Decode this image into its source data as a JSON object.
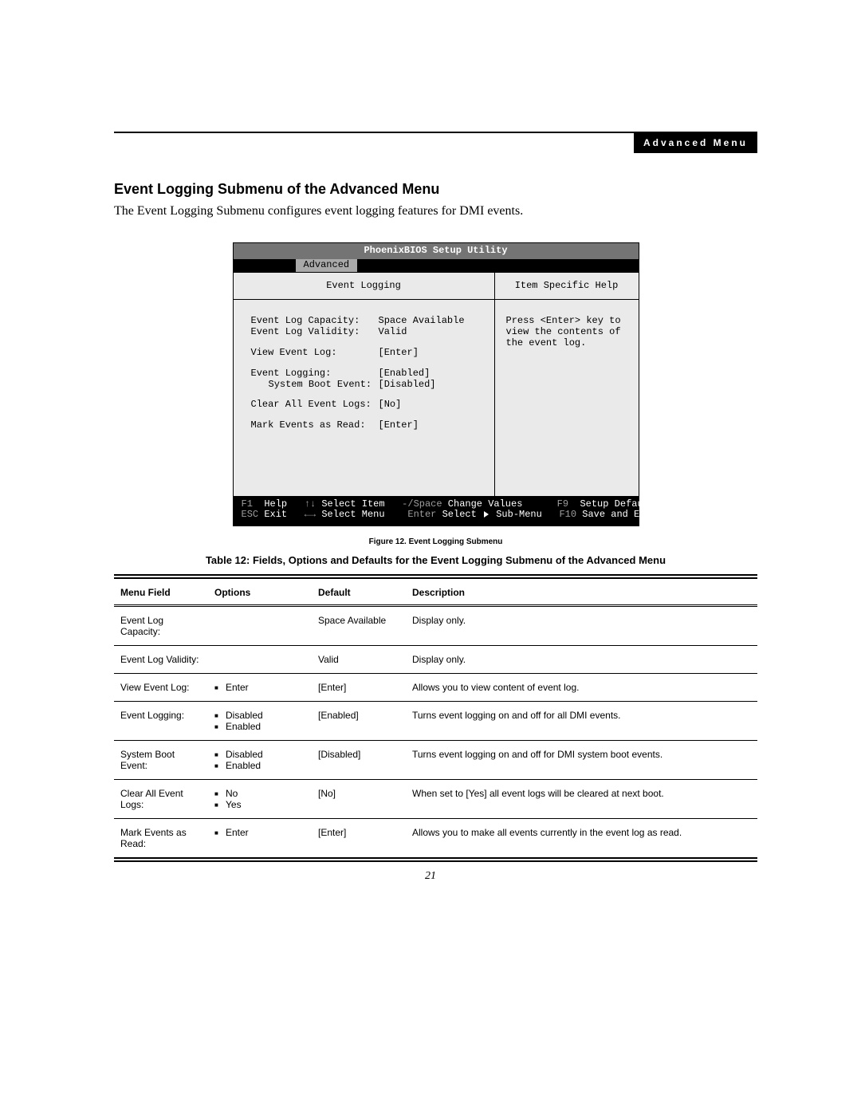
{
  "header": {
    "pill": "Advanced Menu"
  },
  "section_title": "Event Logging Submenu of the Advanced Menu",
  "intro": "The Event Logging Submenu configures event logging features for DMI events.",
  "bios": {
    "title": "PhoenixBIOS Setup Utility",
    "tab": "Advanced",
    "left_header": "Event Logging",
    "right_header": "Item Specific Help",
    "help_lines": [
      "Press <Enter> key to",
      "view the contents of",
      "the event log."
    ],
    "fields": {
      "capacity_label": "Event Log Capacity:",
      "capacity_value": "Space Available",
      "validity_label": "Event Log Validity:",
      "validity_value": "Valid",
      "view_label": "View Event Log:",
      "view_value": "[Enter]",
      "logging_label": "Event Logging:",
      "logging_value": "[Enabled]",
      "boot_label": "System Boot Event:",
      "boot_value": "[Disabled]",
      "clear_label": "Clear All Event Logs:",
      "clear_value": "[No]",
      "mark_label": "Mark Events as Read:",
      "mark_value": "[Enter]"
    },
    "footer": {
      "f1": "F1",
      "help": "Help",
      "sel_item": "Select Item",
      "change": "Change Values",
      "minus_space": "-/Space",
      "f9": "F9",
      "defaults": "Setup Defaults",
      "esc": "ESC",
      "exit": "Exit",
      "sel_menu": "Select Menu",
      "enter": "Enter",
      "submenu": "Select",
      "submenu2": "Sub-Menu",
      "f10": "F10",
      "save": "Save and Exit",
      "arrows_ud": "↑↓",
      "arrows_lr": "←→"
    }
  },
  "fig_caption": "Figure 12.  Event Logging Submenu",
  "table_caption": "Table 12: Fields, Options and Defaults for the Event Logging Submenu of the Advanced Menu",
  "table": {
    "headers": {
      "menu": "Menu Field",
      "options": "Options",
      "default": "Default",
      "description": "Description"
    },
    "rows": [
      {
        "menu": "Event Log Capacity:",
        "options": [],
        "default": "Space Available",
        "desc": "Display only.",
        "indent": false
      },
      {
        "menu": "Event Log Validity:",
        "options": [],
        "default": "Valid",
        "desc": "Display only.",
        "indent": false
      },
      {
        "menu": "View Event Log:",
        "options": [
          "Enter"
        ],
        "default": "[Enter]",
        "desc": "Allows you to view content of event log.",
        "indent": false
      },
      {
        "menu": "Event Logging:",
        "options": [
          "Disabled",
          "Enabled"
        ],
        "default": "[Enabled]",
        "desc": "Turns event logging on and off for all DMI events.",
        "indent": false
      },
      {
        "menu": "System Boot Event:",
        "options": [
          "Disabled",
          "Enabled"
        ],
        "default": "[Disabled]",
        "desc": "Turns event logging on and off for DMI system boot events.",
        "indent": true
      },
      {
        "menu": "Clear All Event Logs:",
        "options": [
          "No",
          "Yes"
        ],
        "default": "[No]",
        "desc": "When set to [Yes] all event logs will be cleared at next boot.",
        "indent": false
      },
      {
        "menu": "Mark Events as Read:",
        "options": [
          "Enter"
        ],
        "default": "[Enter]",
        "desc": "Allows you to make all events currently in the event log as read.",
        "indent": false
      }
    ]
  },
  "page_number": "21"
}
